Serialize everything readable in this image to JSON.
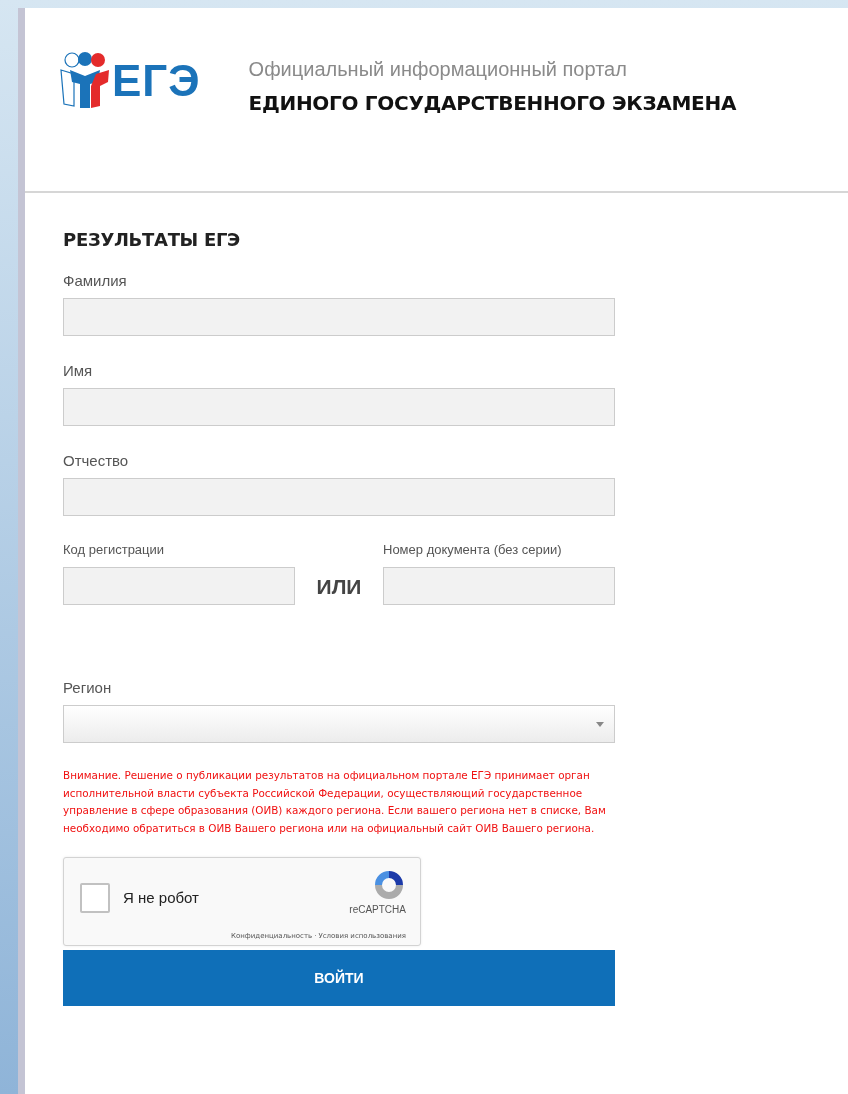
{
  "header": {
    "logo_text": "ЕГЭ",
    "subtitle": "Официальный информационный портал",
    "title": "ЕДИНОГО ГОСУДАРСТВЕННОГО ЭКЗАМЕНА"
  },
  "form": {
    "title": "РЕЗУЛЬТАТЫ ЕГЭ",
    "fields": [
      {
        "kind": "text",
        "label": "Фамилия"
      },
      {
        "kind": "text",
        "label": "Имя"
      },
      {
        "kind": "text",
        "label": "Отчество"
      },
      {
        "kind": "pair",
        "left_label": "Код регистрации",
        "separator": "ИЛИ",
        "right_label": "Номер документа (без серии)"
      },
      {
        "kind": "select",
        "label": "Регион"
      }
    ],
    "warning": "Внимание. Решение о публикации результатов на официальном портале ЕГЭ принимает орган исполнительной власти субъекта Российской Федерации, осуществляющий государственное управление в сфере образования (ОИВ) каждого региона. Если вашего региона нет в списке, Вам необходимо обратиться в ОИВ Вашего региона или на официальный сайт ОИВ Вашего региона.",
    "captcha": {
      "checked": false,
      "label": "Я не робот",
      "brand": "reCAPTCHA",
      "privacy_link": "Конфиденциальность",
      "separator": "·",
      "terms_link": "Условия использования"
    },
    "submit": "ВОЙТИ"
  }
}
